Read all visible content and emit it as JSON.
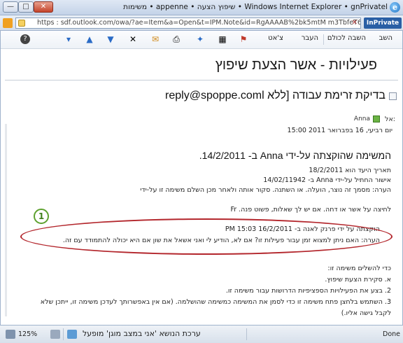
{
  "window": {
    "title": "Windows Internet Explorer • gnPrivatel • שיפוץ הצעה • appenne • משימות",
    "url": "https : sdf.outlook.com/owa/?ae=Item&a=Open&t=IPM.Note&id=RgAAAAB%2bk5mtM m3TbfeT6kX2BwDPit1A/",
    "inprivate_label": "InPrivate",
    "controls": {
      "close": "✕",
      "maximize": "□",
      "minimize": "—"
    }
  },
  "toolbar": {
    "reply": "השב",
    "reply_all": "השבה לכולם",
    "forward": "העבר",
    "junk": "צ'אט"
  },
  "heading": "פעילויות - אשר הצעת שיפוץ",
  "subject": "בדיקת זרימת עבודה [ללא reply@spoppe.coml",
  "to_label": "אל:",
  "to_name": "Anna",
  "date_line": "יום רביעי, 16 בפברואר 2011 15:00",
  "body": {
    "title": "המשימה שהוקצתה על-ידי Anna ב- 14/2/2011.",
    "line1": "תאריך היעד הוא 18/2/2011",
    "line2": "אישור החתיל על-ידי Anna ב- 14/02/11942",
    "line3": "הערה: מסמך זה נוצר, הועלה. או השתנה. סקור אותה ולאחר מכן השלם משימה זו על-ידי",
    "line4": "לחיצה על אשר או דחה. אם יש לך שאלות, פשוט פנה. Fr",
    "callout1": "הוקצתה על ידי פרנק לאנה ב- 16/2/2011 15:03 PM",
    "callout2": "הערה: האם ניתן למצוא זמן עבור פעילות זו? אם לא, הודיע לי ואני אשאל את שון אם היא יכולה להתמודד עם זה.",
    "steps_title": "כדי להשלים משימה זו:",
    "step1": "א. סקירת הצעת שיפוץ.",
    "step2": "2. בצע את הפעילויות הספציפיות הדרושות עבור משימה זו.",
    "step3": "3. השתמש בלחצן פתח משימה זו כדי לסמן את המשימה כמשימה שהושלמה. (אם אין באפשרותך לעדכן משימה זו, ייתכן שלא",
    "step3b": "לקבל גישה אליו.)"
  },
  "callout_marker": "1",
  "status": {
    "done": "Done",
    "mode": "ערכת הנושא 'אני במצב מוגן' מופעל",
    "zoom": "125%"
  }
}
